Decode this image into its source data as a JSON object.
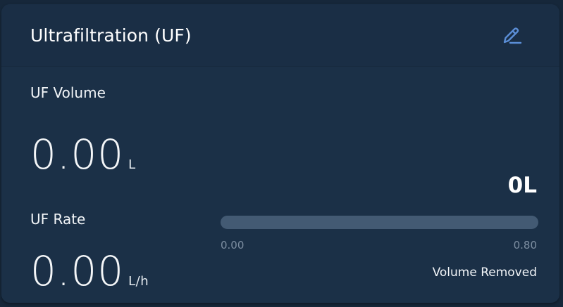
{
  "card": {
    "title": "Ultrafiltration (UF)"
  },
  "uf_volume": {
    "label": "UF Volume",
    "value": "0.00",
    "unit": "L"
  },
  "uf_rate": {
    "label": "UF Rate",
    "value": "0.00",
    "unit": "L/h"
  },
  "volume_removed": {
    "display": "0L",
    "progress_fraction": 0,
    "scale_min": "0.00",
    "scale_max": "0.80",
    "caption": "Volume Removed"
  },
  "icons": {
    "edit": "pencil-icon"
  },
  "colors": {
    "background": "#16273a",
    "card": "#1b3047",
    "accent": "#5b8ed6",
    "track": "#435a73"
  }
}
